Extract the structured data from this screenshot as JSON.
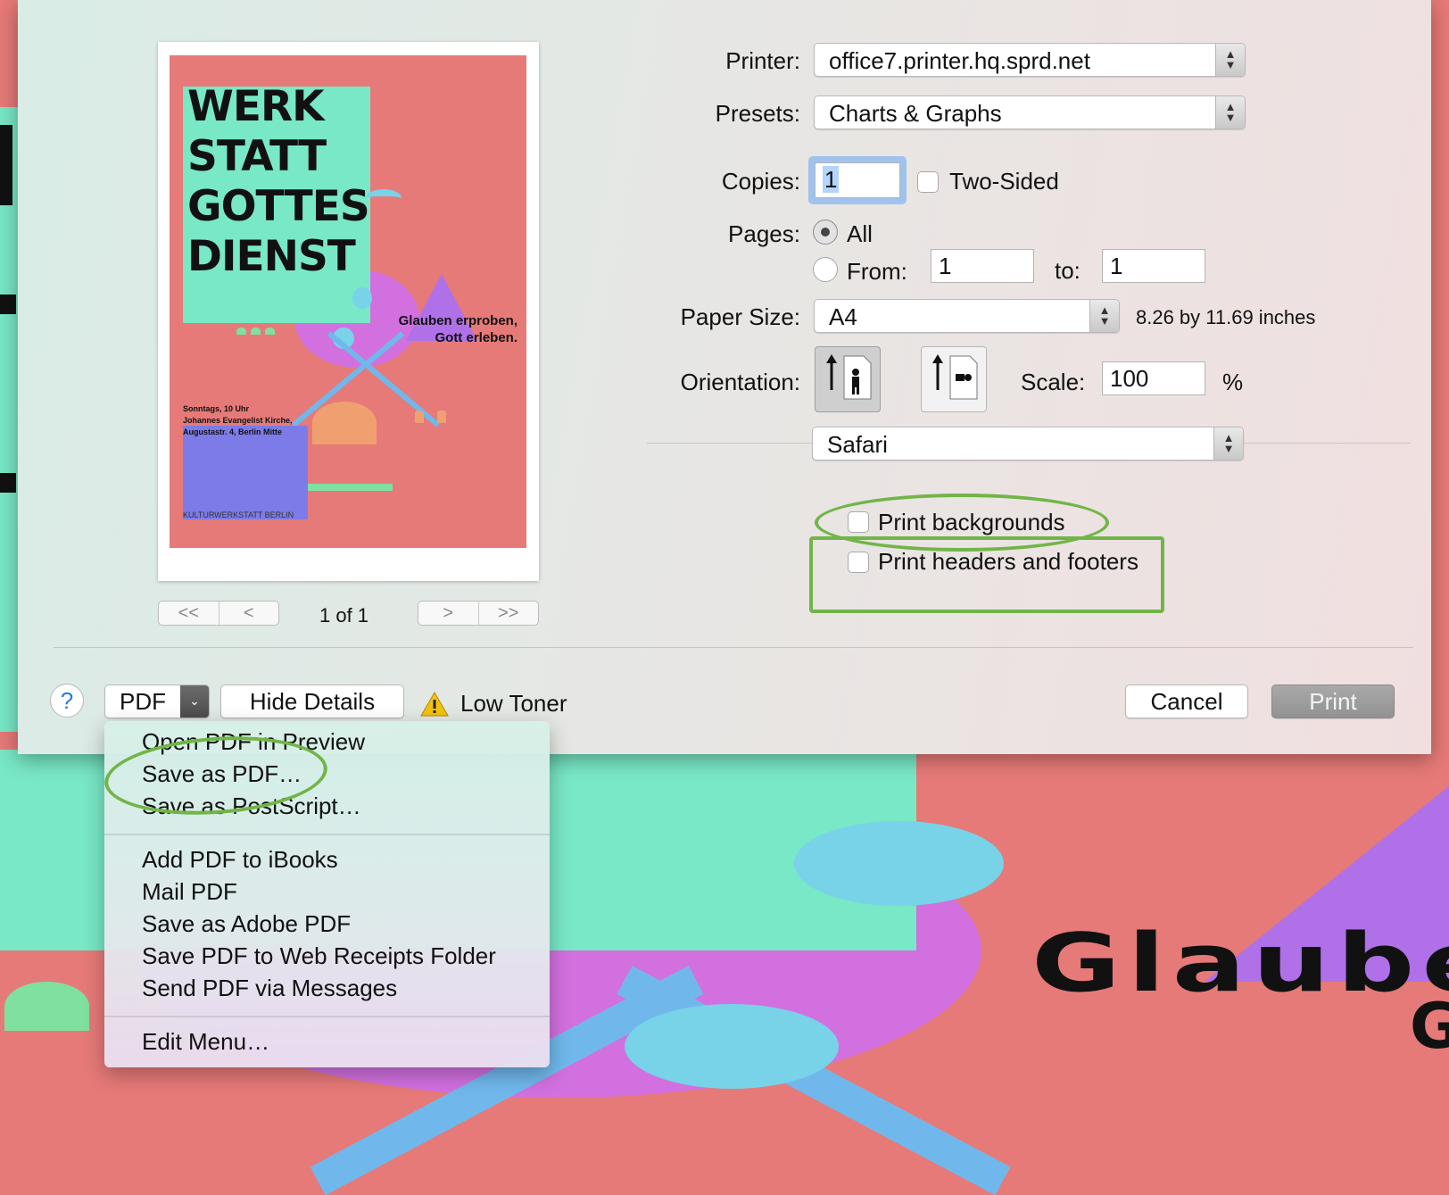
{
  "preview": {
    "poster_title_lines": [
      "WERK",
      "STATT",
      "GOTTES",
      "DIENST"
    ],
    "poster_subtitle_lines": [
      "Glauben erproben,",
      "Gott erleben."
    ],
    "poster_info_lines": [
      "Sonntags, 10 Uhr",
      "Johannes Evangelist Kirche,",
      "Augustastr. 4, Berlin Mitte"
    ],
    "poster_footer": "KULTURWERKSTATT BERLIN",
    "page_indicator": "1 of 1",
    "pager_first": "<<",
    "pager_prev": "<",
    "pager_next": ">",
    "pager_last": ">>"
  },
  "form": {
    "printer_label": "Printer:",
    "printer_value": "office7.printer.hq.sprd.net",
    "presets_label": "Presets:",
    "presets_value": "Charts & Graphs",
    "copies_label": "Copies:",
    "copies_value": "1",
    "two_sided_label": "Two-Sided",
    "pages_label": "Pages:",
    "pages_all_label": "All",
    "pages_from_label": "From:",
    "pages_from_value": "1",
    "pages_to_label": "to:",
    "pages_to_value": "1",
    "paper_size_label": "Paper Size:",
    "paper_size_value": "A4",
    "paper_size_dims": "8.26 by 11.69 inches",
    "orientation_label": "Orientation:",
    "scale_label": "Scale:",
    "scale_value": "100",
    "scale_unit": "%",
    "app_section_value": "Safari",
    "print_backgrounds_label": "Print backgrounds",
    "print_headers_label": "Print headers and footers"
  },
  "footer": {
    "help_label": "?",
    "pdf_label": "PDF",
    "hide_details_label": "Hide Details",
    "low_toner_label": "Low Toner",
    "cancel_label": "Cancel",
    "print_label": "Print"
  },
  "pdf_menu": {
    "group1": [
      "Open PDF in Preview",
      "Save as PDF…",
      "Save as PostScript…"
    ],
    "group2": [
      "Add PDF to iBooks",
      "Mail PDF",
      "Save as Adobe PDF",
      "Save PDF to Web Receipts Folder",
      "Send PDF via Messages"
    ],
    "group3": [
      "Edit Menu…"
    ]
  },
  "background_page": {
    "text_line1": "Glaube",
    "text_line2": "G"
  },
  "colors": {
    "annotation_green": "#71b548",
    "poster_salmon": "#e67a78",
    "poster_teal": "#78e8c6",
    "accent_blue": "#2f7bd8"
  },
  "icons": {
    "warning": "warning-icon",
    "help": "help-icon",
    "popup_arrows": "up-down-chevron-icon",
    "portrait": "portrait-orientation-icon",
    "landscape": "landscape-orientation-icon"
  }
}
